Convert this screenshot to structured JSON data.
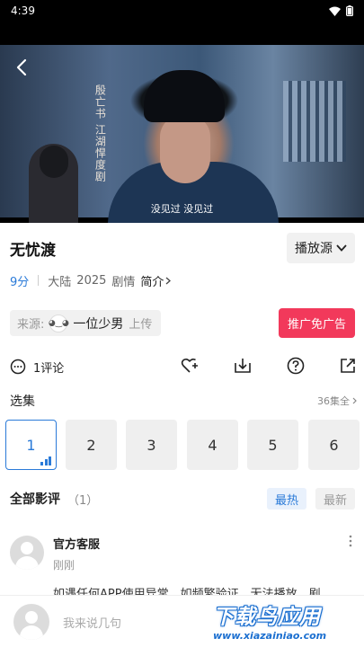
{
  "status_bar": {
    "time": "4:39"
  },
  "video": {
    "calligraphy": "殷亡书 江湖悍度剧",
    "subtitle": "没见过 没见过"
  },
  "header": {
    "title": "无忧渡",
    "source_label": "播放源"
  },
  "meta": {
    "score": "9分",
    "region": "大陆",
    "year": "2025",
    "genre": "剧情",
    "intro_label": "简介"
  },
  "uploader": {
    "prefix": "来源:",
    "name": "一位少男",
    "suffix": "上传",
    "promo_label": "推广免广告"
  },
  "actions": {
    "comment_count": "1评论"
  },
  "episodes": {
    "title": "选集",
    "all_label": "36集全",
    "items": [
      "1",
      "2",
      "3",
      "4",
      "5",
      "6"
    ],
    "active_index": 0
  },
  "reviews": {
    "title": "全部影评",
    "count": "（1）",
    "sort_hot": "最热",
    "sort_new": "最新",
    "items": [
      {
        "author": "官方客服",
        "time": "刚刚",
        "text": "如遇任何APP使用异常，如频繁验证、无法播放、剧"
      }
    ]
  },
  "bottom": {
    "placeholder": "我来说几句"
  },
  "watermark": {
    "title": "下载鸟应用",
    "url": "www.xiazainiao.com"
  },
  "colors": {
    "accent": "#2a7ad8",
    "promo": "#f2395b",
    "watermark": "#1b6fd0"
  },
  "icons": [
    "back-icon",
    "wifi-icon",
    "battery-icon",
    "chevron-down-icon",
    "chevron-right-icon",
    "comment-icon",
    "favorite-heart-icon",
    "download-icon",
    "help-icon",
    "share-icon",
    "more-vertical-icon",
    "playing-bars-icon"
  ]
}
